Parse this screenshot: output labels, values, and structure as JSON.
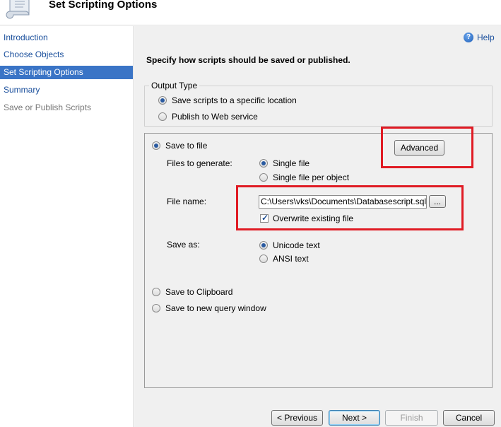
{
  "header": {
    "title": "Set Scripting Options"
  },
  "sidebar": {
    "items": [
      {
        "label": "Introduction",
        "state": "link"
      },
      {
        "label": "Choose Objects",
        "state": "link"
      },
      {
        "label": "Set Scripting Options",
        "state": "active"
      },
      {
        "label": "Summary",
        "state": "link"
      },
      {
        "label": "Save or Publish Scripts",
        "state": "disabled"
      }
    ]
  },
  "help": {
    "label": "Help",
    "icon": "help-icon"
  },
  "main": {
    "instruction": "Specify how scripts should be saved or published.",
    "output_type": {
      "legend": "Output Type",
      "options": [
        {
          "label": "Save scripts to a specific location",
          "checked": true
        },
        {
          "label": "Publish to Web service",
          "checked": false
        }
      ]
    },
    "save_to_file": {
      "label": "Save to file",
      "checked": true,
      "advanced_button": "Advanced",
      "files_to_generate": {
        "label": "Files to generate:",
        "options": [
          {
            "label": "Single file",
            "checked": true
          },
          {
            "label": "Single file per object",
            "checked": false
          }
        ]
      },
      "file_name": {
        "label": "File name:",
        "value": "C:\\Users\\vks\\Documents\\Databasescript.sql",
        "browse_button": "...",
        "overwrite": {
          "label": "Overwrite existing file",
          "checked": true
        }
      },
      "save_as": {
        "label": "Save as:",
        "options": [
          {
            "label": "Unicode text",
            "checked": true
          },
          {
            "label": "ANSI text",
            "checked": false
          }
        ]
      }
    },
    "save_to_clipboard": {
      "label": "Save to Clipboard",
      "checked": false
    },
    "save_to_query_window": {
      "label": "Save to new query window",
      "checked": false
    }
  },
  "footer": {
    "previous": "< Previous",
    "next": "Next >",
    "finish": "Finish",
    "cancel": "Cancel"
  },
  "colors": {
    "accent": "#3a74c6",
    "link": "#1a4f9c",
    "annotation": "#e01b24"
  }
}
